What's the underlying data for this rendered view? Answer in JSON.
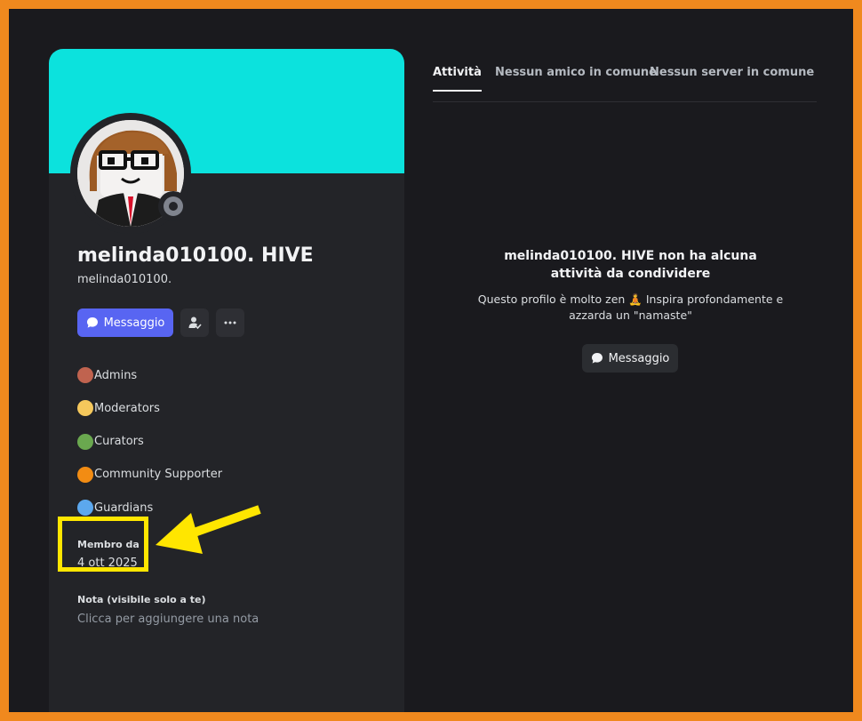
{
  "colors": {
    "frame": "#f0891e",
    "banner": "#0ce2dd",
    "accent": "#5865f2",
    "highlight": "#ffe600"
  },
  "profile": {
    "display_name": "melinda010100. HIVE",
    "username": "melinda010100.",
    "message_button": "Messaggio",
    "roles": [
      {
        "label": "Admins",
        "color": "#c0634f"
      },
      {
        "label": "Moderators",
        "color": "#f5c85c"
      },
      {
        "label": "Curators",
        "color": "#6aa84f"
      },
      {
        "label": "Community Supporter",
        "color": "#f28c13"
      },
      {
        "label": "Guardians",
        "color": "#5ca8ee"
      }
    ],
    "member_since_label": "Membro da",
    "member_since_date": "4 ott 2025",
    "note_label": "Nota (visibile solo a te)",
    "note_placeholder": "Clicca per aggiungere una nota"
  },
  "tabs": [
    {
      "label": "Attività",
      "active": true
    },
    {
      "label": "Nessun amico in comune",
      "active": false
    },
    {
      "label": "Nessun server in comune",
      "active": false
    }
  ],
  "activity": {
    "empty_title": "melinda010100. HIVE non ha alcuna attività da condividere",
    "empty_subtitle": "Questo profilo è molto zen 🧘 Inspira profondamente e azzarda un \"namaste\"",
    "message_button": "Messaggio"
  }
}
